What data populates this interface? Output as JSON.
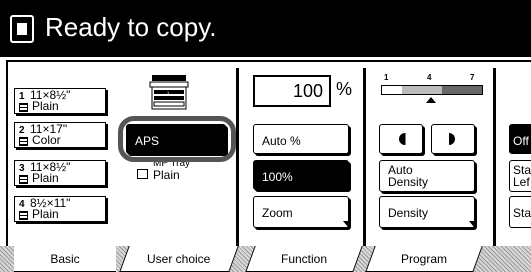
{
  "status": {
    "title": "Ready to copy."
  },
  "trays": [
    {
      "num": "1",
      "size": "11×8½\"",
      "type": "Plain"
    },
    {
      "num": "2",
      "size": "11×17\"",
      "type": "Color"
    },
    {
      "num": "3",
      "size": "11×8½\"",
      "type": "Plain"
    },
    {
      "num": "4",
      "size": "8½×11\"",
      "type": "Plain"
    }
  ],
  "paper": {
    "aps_label": "APS",
    "mp_tray_label": "MP Tray",
    "mp_tray_type": "Plain"
  },
  "zoom": {
    "value": "100",
    "unit": "%",
    "auto_label": "Auto %",
    "full_label": "100%",
    "zoom_label": "Zoom"
  },
  "density": {
    "scale": [
      "1",
      "4",
      "7"
    ],
    "level": 4,
    "auto_label_line1": "Auto",
    "auto_label_line2": "Density",
    "density_label": "Density"
  },
  "edge": {
    "off_label": "Off",
    "staple_line1": "Sta",
    "staple_line2": "Lef",
    "staple2_label": "Sta"
  },
  "tabs": [
    {
      "label": "Basic",
      "active": true
    },
    {
      "label": "User choice",
      "active": false
    },
    {
      "label": "Function",
      "active": false
    },
    {
      "label": "Program",
      "active": false
    }
  ]
}
